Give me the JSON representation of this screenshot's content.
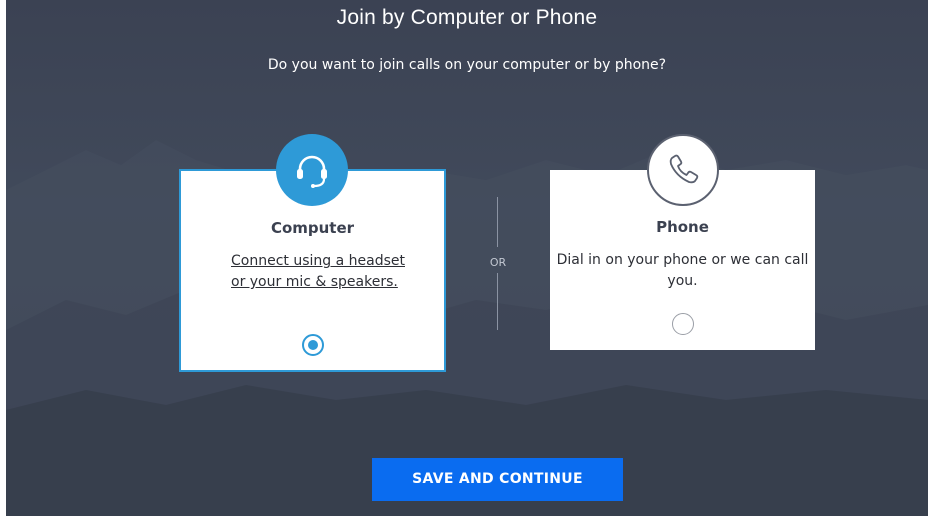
{
  "dialog": {
    "title": "Join by Computer or Phone",
    "subtitle": "Do you want to join calls on your computer or by phone?"
  },
  "options": {
    "computer": {
      "title": "Computer",
      "description": "Connect using a headset or your mic & speakers.",
      "icon": "headset-icon",
      "selected": true
    },
    "phone": {
      "title": "Phone",
      "description": "Dial in on your phone or we can call you.",
      "icon": "phone-icon",
      "selected": false
    }
  },
  "divider": {
    "label": "OR"
  },
  "actions": {
    "save_label": "SAVE AND CONTINUE"
  },
  "colors": {
    "accent": "#2e9ad7",
    "button": "#0a6cf0",
    "background": "#3f4757"
  }
}
